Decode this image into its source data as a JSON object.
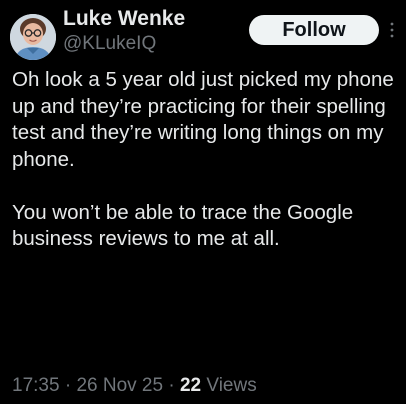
{
  "author": {
    "display_name": "Luke Wenke",
    "handle": "@KLukeIQ",
    "avatar_icon": "person-avatar-icon"
  },
  "actions": {
    "follow_label": "Follow",
    "more_icon": "more-vertical-icon"
  },
  "post": {
    "text": "Oh look a 5 year old just picked my phone up and they’re practicing for their spelling test and they’re writing long things on my phone.\n\nYou won’t be able to trace the Google business reviews to me at all."
  },
  "meta": {
    "time": "17:35",
    "separator": "·",
    "date": "26 Nov 25",
    "views_count": "22",
    "views_label": "Views"
  },
  "colors": {
    "background": "#000000",
    "primary_text": "#e7e9ea",
    "secondary_text": "#71767b",
    "follow_bg": "#eff3f4",
    "follow_text": "#0f1419"
  }
}
